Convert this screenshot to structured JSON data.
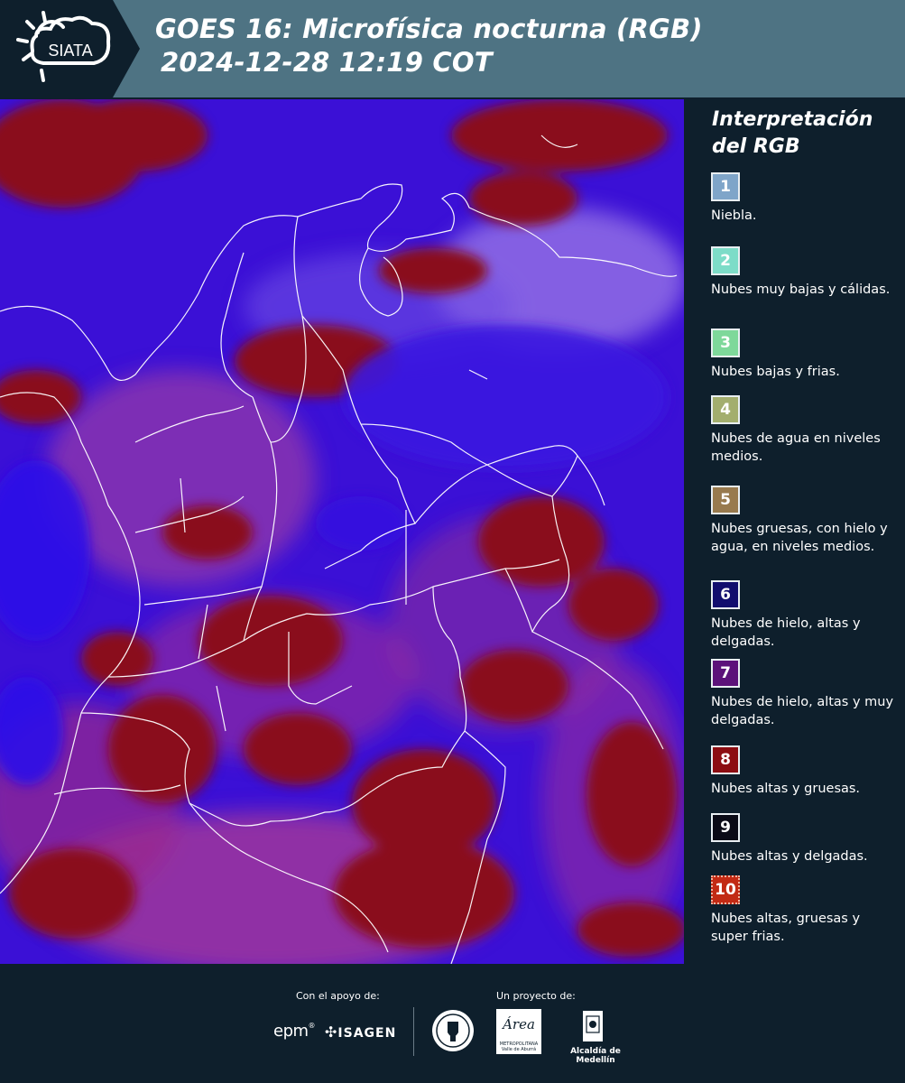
{
  "header": {
    "logo_text": "SIATA",
    "title_line1": "GOES 16: Microfísica nocturna (RGB)",
    "title_line2": "2024-12-28 12:19 COT"
  },
  "map": {
    "icon": "satellite-rgb-map",
    "colors": {
      "ocean": "#3a0cd8",
      "thick_cloud": "#8a0a1c",
      "thin_cloud": "#b23aa8",
      "border": "#ffffff"
    }
  },
  "legend": {
    "title_line1": "Interpretación",
    "title_line2": "del RGB",
    "items": [
      {
        "number": "1",
        "color": "#7fa5c9",
        "text": "Niebla."
      },
      {
        "number": "2",
        "color": "#7ddcc8",
        "text": "Nubes muy bajas y cálidas."
      },
      {
        "number": "3",
        "color": "#7ed89a",
        "text": "Nubes bajas y frias."
      },
      {
        "number": "4",
        "color": "#a3ae6e",
        "text": "Nubes de agua en niveles medios."
      },
      {
        "number": "5",
        "color": "#987a4e",
        "text": "Nubes gruesas, con hielo y agua, en niveles medios."
      },
      {
        "number": "6",
        "color": "#120e6e",
        "text": "Nubes de hielo, altas y delgadas."
      },
      {
        "number": "7",
        "color": "#5c127a",
        "text": "Nubes de hielo, altas y muy delgadas."
      },
      {
        "number": "8",
        "color": "#8c0d12",
        "text": "Nubes altas y gruesas."
      },
      {
        "number": "9",
        "color": "#0a0a16",
        "text": "Nubes altas y delgadas."
      },
      {
        "number": "10",
        "color": "#c22a14",
        "text": "Nubes altas, gruesas y super frias."
      }
    ]
  },
  "footer": {
    "support_label": "Con el apoyo de:",
    "project_label": "Un proyecto de:",
    "sponsor_epm": "epm",
    "sponsor_isagen": "ISAGEN",
    "area_text": "Área",
    "area_sub": "METROPOLITANA",
    "area_sub2": "Valle de Aburrá",
    "alcaldia": "Alcaldía de Medellín"
  }
}
